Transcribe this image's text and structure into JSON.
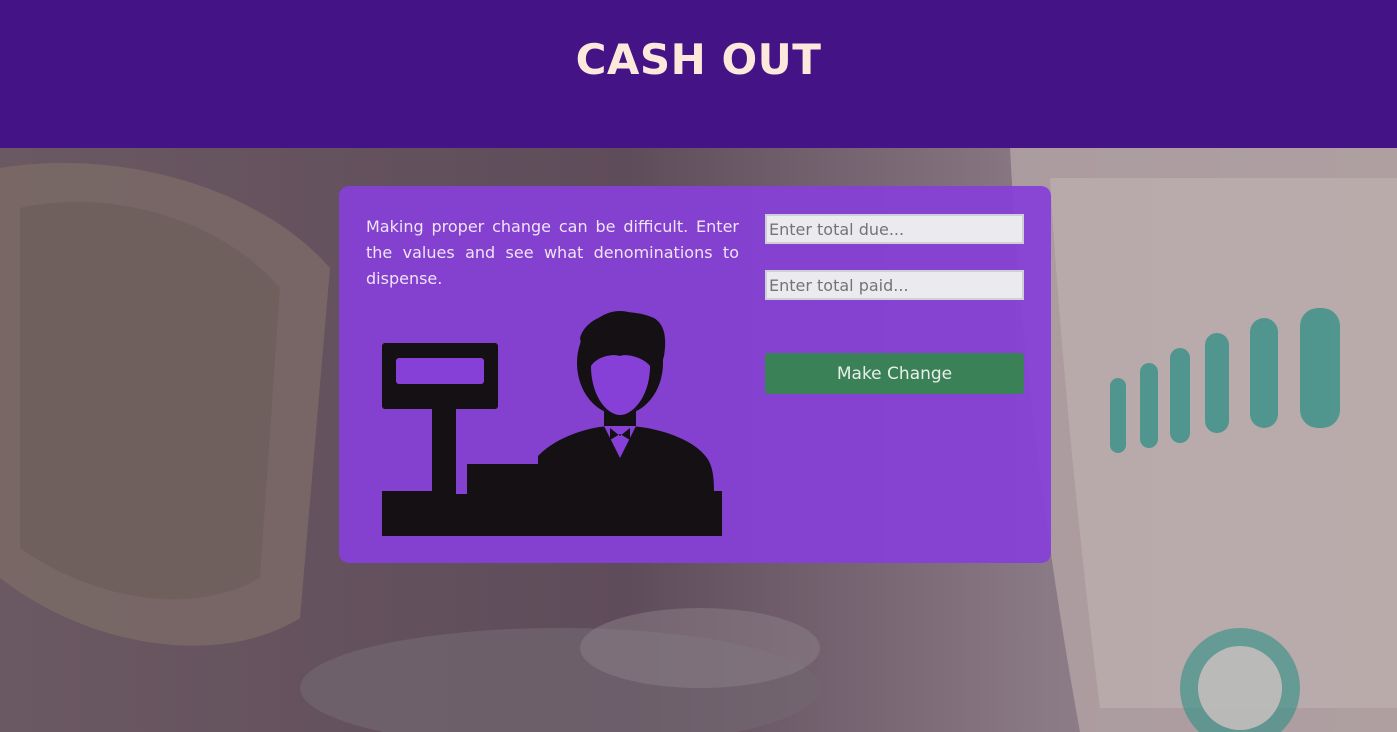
{
  "header": {
    "title": "CASH OUT"
  },
  "card": {
    "description": "Making proper change can be difficult. Enter the values and see what denominations to dispense.",
    "illustration_icon": "cashier-register-icon",
    "total_due": {
      "value": "",
      "placeholder": "Enter total due..."
    },
    "total_paid": {
      "value": "",
      "placeholder": "Enter total paid..."
    },
    "make_change_label": "Make Change"
  },
  "colors": {
    "header_bg": "#441386",
    "title_text": "#fce9dc",
    "card_bg": "#8640d8",
    "button_bg": "#3a8157"
  }
}
